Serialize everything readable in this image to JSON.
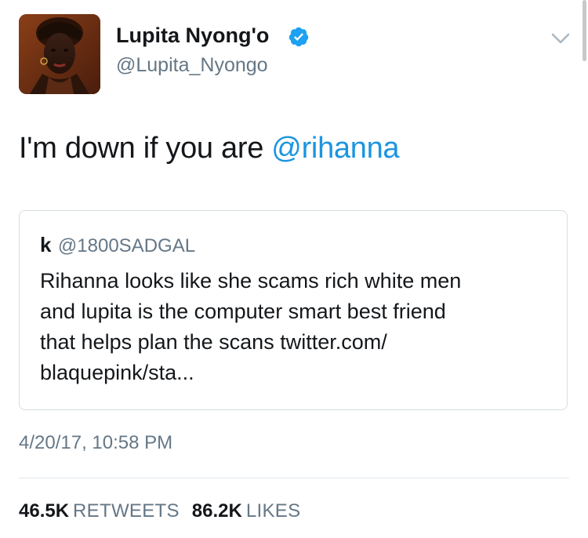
{
  "author": {
    "display_name": "Lupita Nyong'o",
    "handle": "@Lupita_Nyongo",
    "verified": true,
    "avatar_icon": "profile-photo"
  },
  "tweet": {
    "text": "I'm down if you are ",
    "mention": "@rihanna"
  },
  "quoted_tweet": {
    "name": "k",
    "handle": "@1800SADGAL",
    "lines": [
      "Rihanna looks like she scams rich white men",
      "and lupita is the computer smart best friend",
      "that helps plan the scans twitter.com/",
      "blaquepink/sta..."
    ]
  },
  "timestamp": "4/20/17, 10:58 PM",
  "stats": {
    "retweets_count": "46.5K",
    "retweets_label": "RETWEETS",
    "likes_count": "86.2K",
    "likes_label": "LIKES"
  },
  "colors": {
    "mention": "#1b95e0",
    "verified_badge": "#1da1f2",
    "secondary_text": "#657786",
    "primary_text": "#14171a",
    "border": "#d6dde2"
  },
  "icons": {
    "verified": "verified-badge-icon",
    "menu": "chevron-down-icon"
  }
}
